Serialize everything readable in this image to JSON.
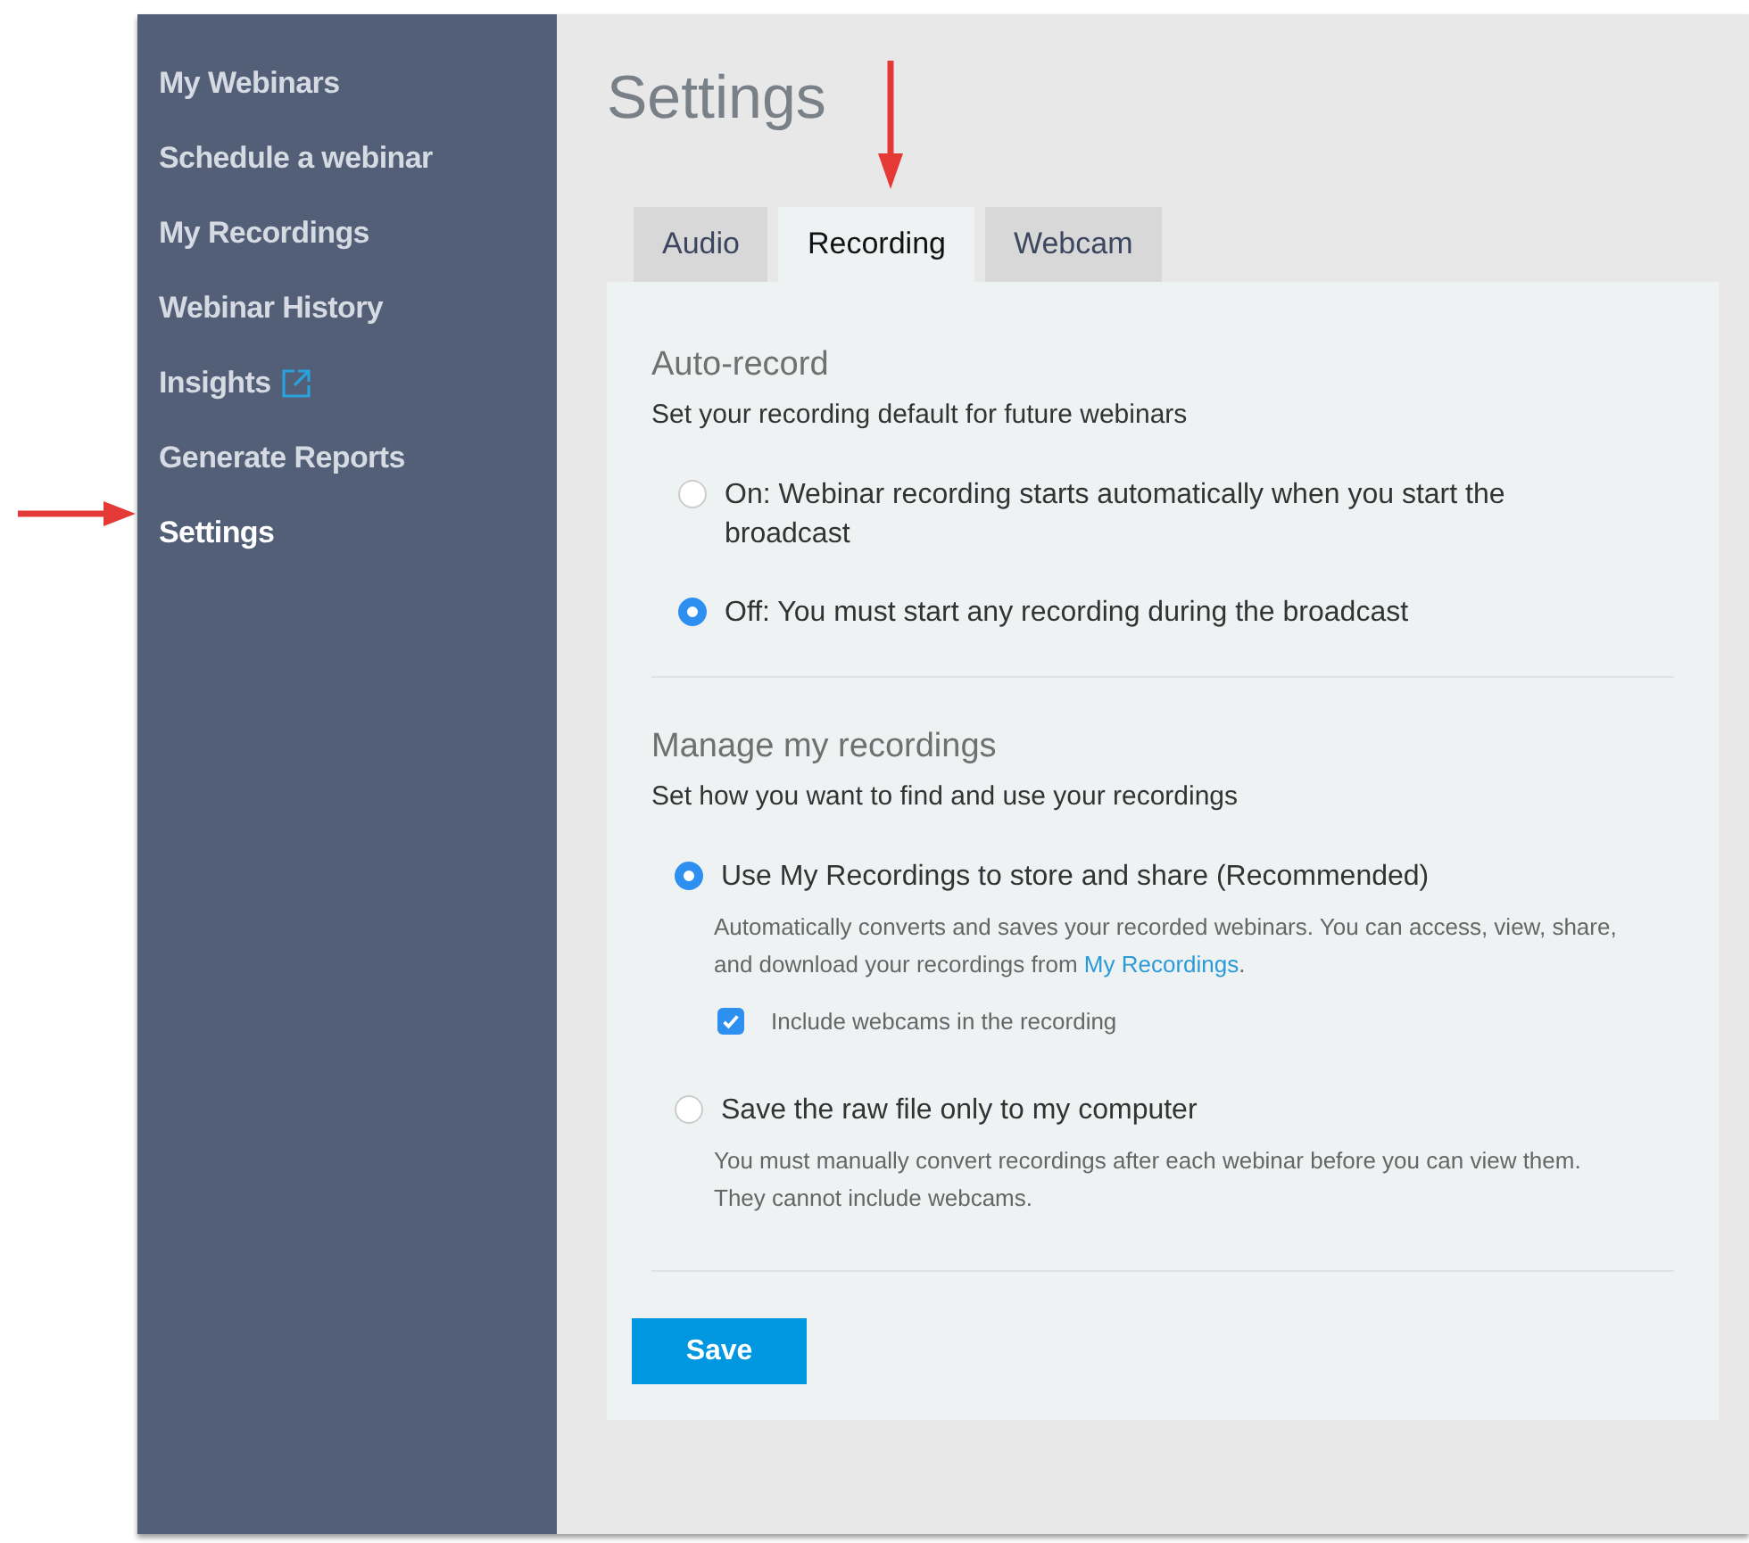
{
  "sidebar": {
    "items": [
      {
        "label": "My Webinars",
        "selected": false,
        "external": false
      },
      {
        "label": "Schedule a webinar",
        "selected": false,
        "external": false
      },
      {
        "label": "My Recordings",
        "selected": false,
        "external": false
      },
      {
        "label": "Webinar History",
        "selected": false,
        "external": false
      },
      {
        "label": "Insights",
        "selected": false,
        "external": true
      },
      {
        "label": "Generate Reports",
        "selected": false,
        "external": false
      },
      {
        "label": "Settings",
        "selected": true,
        "external": false
      }
    ]
  },
  "page_title": "Settings",
  "tabs": [
    {
      "label": "Audio",
      "selected": false
    },
    {
      "label": "Recording",
      "selected": true
    },
    {
      "label": "Webcam",
      "selected": false
    }
  ],
  "auto_record": {
    "title": "Auto-record",
    "subtitle": "Set your recording default for future webinars",
    "options": [
      {
        "label": "On: Webinar recording starts automatically when you start the broadcast",
        "selected": false
      },
      {
        "label": "Off: You must start any recording during the broadcast",
        "selected": true
      }
    ]
  },
  "manage": {
    "title": "Manage my recordings",
    "subtitle": "Set how you want to find and use your recordings",
    "options": [
      {
        "label": "Use My Recordings to store and share (Recommended)",
        "selected": true,
        "description": "Automatically converts and saves your recorded webinars. You can access, view, share, and download your recordings from",
        "link": "My Recordings",
        "after_link": ".",
        "checkbox": {
          "label": "Include webcams in the recording",
          "checked": true
        }
      },
      {
        "label": "Save the raw file only to my computer",
        "selected": false,
        "description": "You must manually convert recordings after each webinar before you can view them. They cannot include webcams."
      }
    ]
  },
  "save_button": "Save"
}
